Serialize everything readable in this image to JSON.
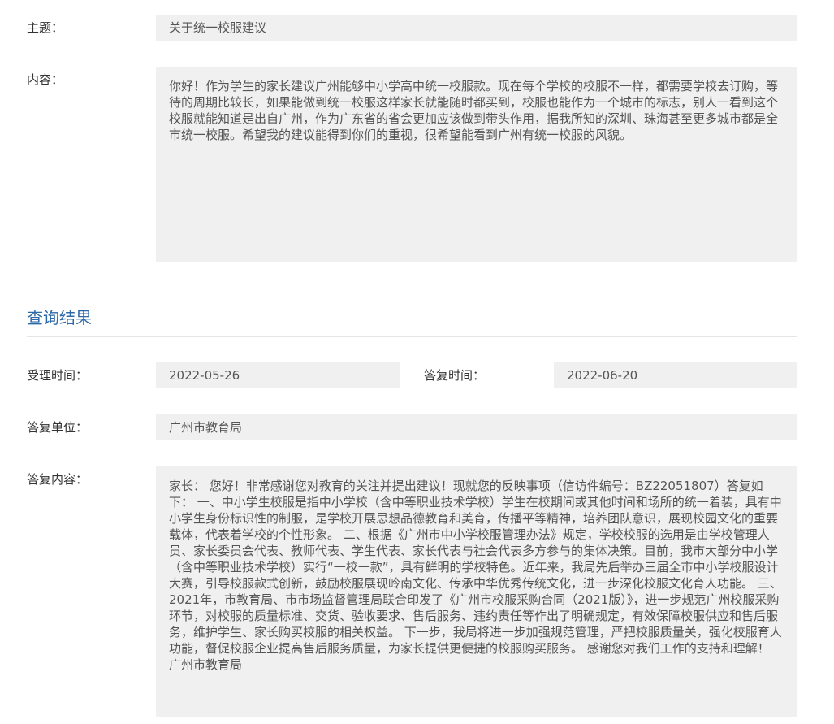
{
  "subject": {
    "label": "主题：",
    "value": "关于统一校服建议"
  },
  "content": {
    "label": "内容：",
    "value": "你好！作为学生的家长建议广州能够中小学高中统一校服款。现在每个学校的校服不一样，都需要学校去订购，等待的周期比较长，如果能做到统一校服这样家长就能随时都买到，校服也能作为一个城市的标志，别人一看到这个校服就能知道是出自广州，作为广东省的省会更加应该做到带头作用，据我所知的深圳、珠海甚至更多城市都是全市统一校服。希望我的建议能得到你们的重视，很希望能看到广州有统一校服的风貌。"
  },
  "results": {
    "title": "查询结果",
    "accept_time": {
      "label": "受理时间：",
      "value": "2022-05-26"
    },
    "reply_time": {
      "label": "答复时间：",
      "value": "2022-06-20"
    },
    "reply_unit": {
      "label": "答复单位：",
      "value": "广州市教育局"
    },
    "reply_content": {
      "label": "答复内容：",
      "value": "家长： 您好！非常感谢您对教育的关注并提出建议！现就您的反映事项（信访件编号：BZ22051807）答复如下： 一、中小学生校服是指中小学校（含中等职业技术学校）学生在校期间或其他时间和场所的统一着装，具有中小学生身份标识性的制服，是学校开展思想品德教育和美育，传播平等精神，培养团队意识，展现校园文化的重要载体，代表着学校的个性形象。 二、根据《广州市中小学校服管理办法》规定，学校校服的选用是由学校管理人员、家长委员会代表、教师代表、学生代表、家长代表与社会代表多方参与的集体决策。目前，我市大部分中小学（含中等职业技术学校）实行“一校一款”，具有鲜明的学校特色。近年来，我局先后举办三届全市中小学校服设计大赛，引导校服款式创新，鼓励校服展现岭南文化、传承中华优秀传统文化，进一步深化校服文化育人功能。 三、2021年，市教育局、市市场监督管理局联合印发了《广州市校服采购合同（2021版）》，进一步规范广州校服采购环节，对校服的质量标准、交货、验收要求、售后服务、违约责任等作出了明确规定，有效保障校服供应和售后服务，维护学生、家长购买校服的相关权益。 下一步，我局将进一步加强规范管理，严把校服质量关，强化校服育人功能，督促校服企业提高售后服务质量，为家长提供更便捷的校服购买服务。 感谢您对我们工作的支持和理解！ 广州市教育局"
    }
  }
}
